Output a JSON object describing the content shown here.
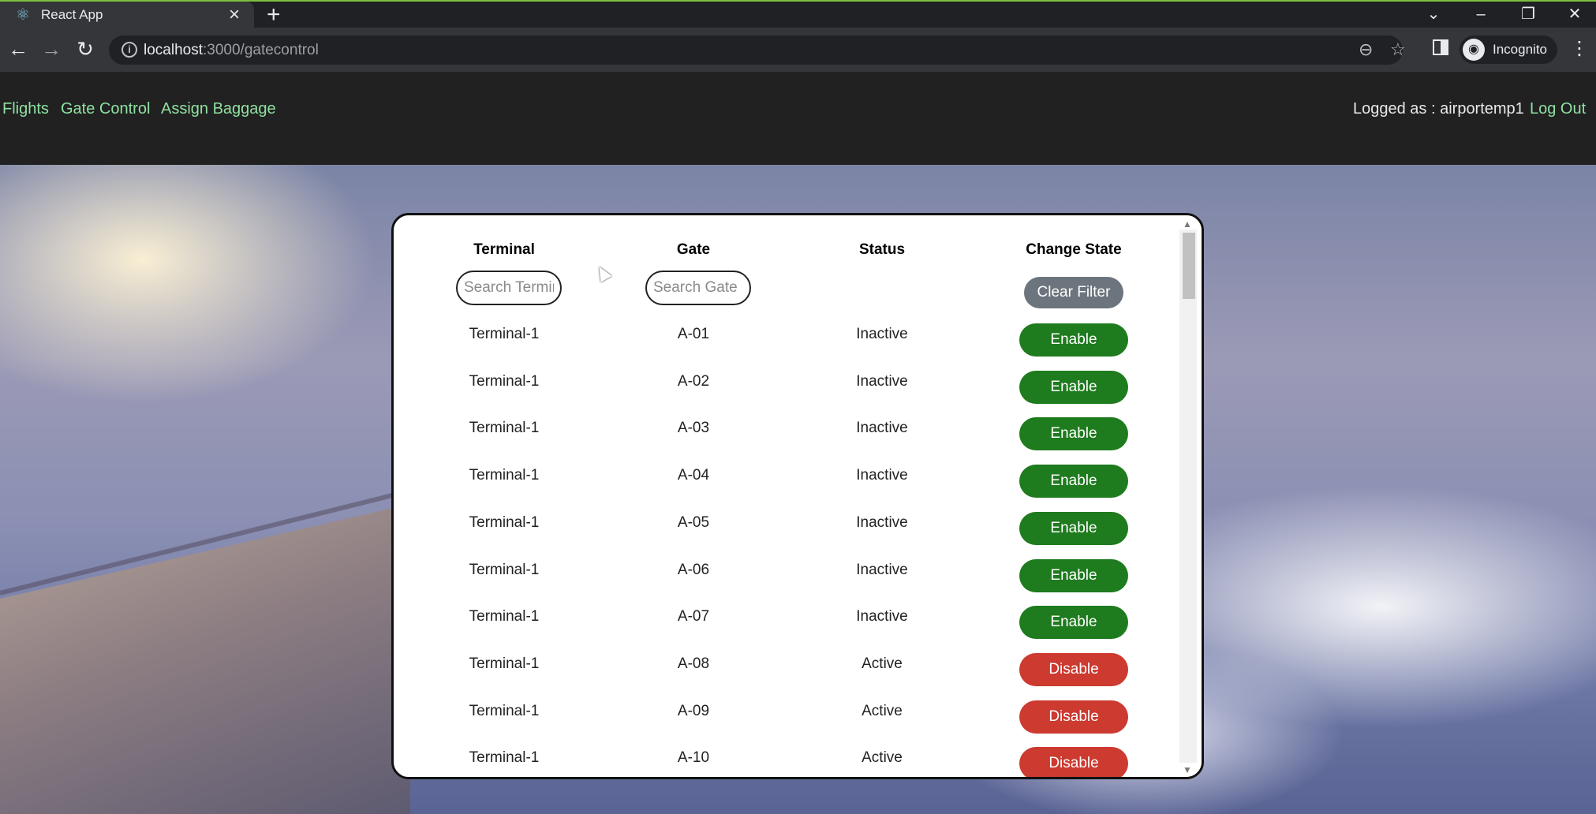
{
  "browser": {
    "tab_title": "React App",
    "url_host": "localhost",
    "url_path": ":3000/gatecontrol",
    "profile_label": "Incognito"
  },
  "navbar": {
    "links": [
      "Flights",
      "Gate Control",
      "Assign Baggage"
    ],
    "logged_as": "Logged as : airportemp1",
    "logout_label": "Log Out"
  },
  "table": {
    "headers": {
      "terminal": "Terminal",
      "gate": "Gate",
      "status": "Status",
      "change_state": "Change State"
    },
    "search_terminal_placeholder": "Search Terminal",
    "search_gate_placeholder": "Search Gate",
    "clear_filter_label": "Clear Filter",
    "rows": [
      {
        "terminal": "Terminal-1",
        "gate": "A-01",
        "status": "Inactive",
        "action": "Enable"
      },
      {
        "terminal": "Terminal-1",
        "gate": "A-02",
        "status": "Inactive",
        "action": "Enable"
      },
      {
        "terminal": "Terminal-1",
        "gate": "A-03",
        "status": "Inactive",
        "action": "Enable"
      },
      {
        "terminal": "Terminal-1",
        "gate": "A-04",
        "status": "Inactive",
        "action": "Enable"
      },
      {
        "terminal": "Terminal-1",
        "gate": "A-05",
        "status": "Inactive",
        "action": "Enable"
      },
      {
        "terminal": "Terminal-1",
        "gate": "A-06",
        "status": "Inactive",
        "action": "Enable"
      },
      {
        "terminal": "Terminal-1",
        "gate": "A-07",
        "status": "Inactive",
        "action": "Enable"
      },
      {
        "terminal": "Terminal-1",
        "gate": "A-08",
        "status": "Active",
        "action": "Disable"
      },
      {
        "terminal": "Terminal-1",
        "gate": "A-09",
        "status": "Active",
        "action": "Disable"
      },
      {
        "terminal": "Terminal-1",
        "gate": "A-10",
        "status": "Active",
        "action": "Disable"
      }
    ]
  },
  "colors": {
    "nav_link": "#8fe0a2",
    "enable": "#1e7b1e",
    "disable": "#cc3a30",
    "clear_filter": "#6c757d"
  },
  "icons": {
    "tab_favicon": "react-icon",
    "tab_close": "close-icon",
    "new_tab": "plus-icon",
    "back": "arrow-left-icon",
    "forward": "arrow-right-icon",
    "reload": "reload-icon",
    "site_info": "info-icon",
    "zoom": "zoom-out-icon",
    "bookmark": "star-icon",
    "side_panel": "side-panel-icon",
    "profile": "incognito-icon",
    "menu": "kebab-menu-icon"
  }
}
